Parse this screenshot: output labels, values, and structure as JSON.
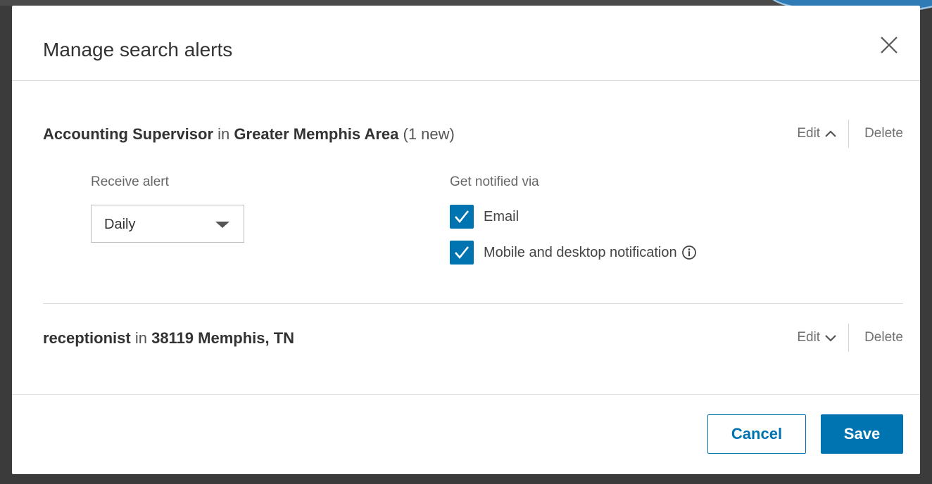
{
  "modal": {
    "title": "Manage search alerts"
  },
  "alerts": [
    {
      "keyword": "Accounting Supervisor",
      "connector": "in",
      "location": "Greater Memphis Area",
      "new_count": "(1 new)",
      "edit_label": "Edit",
      "delete_label": "Delete",
      "expanded": true,
      "receive_label": "Receive alert",
      "frequency": "Daily",
      "notify_label": "Get notified via",
      "channels": [
        {
          "label": "Email",
          "checked": true
        },
        {
          "label": "Mobile and desktop notification",
          "checked": true
        }
      ]
    },
    {
      "keyword": "receptionist",
      "connector": "in",
      "location": "38119 Memphis, TN",
      "edit_label": "Edit",
      "delete_label": "Delete",
      "expanded": false
    }
  ],
  "footer": {
    "cancel_label": "Cancel",
    "save_label": "Save"
  },
  "colors": {
    "accent": "#0073b1",
    "overlay": "#3b3b3b"
  },
  "icons": {
    "close": "close-icon",
    "edit_expanded": "chevron-up-icon",
    "edit_collapsed": "chevron-down-icon",
    "checkbox": "checkmark-icon",
    "info": "info-icon",
    "select": "caret-down-icon"
  }
}
